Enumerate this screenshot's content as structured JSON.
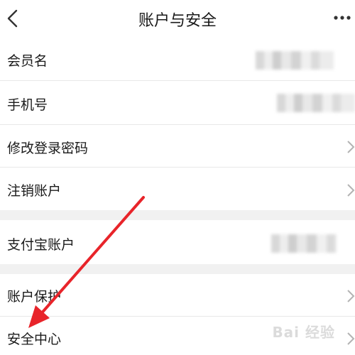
{
  "header": {
    "title": "账户与安全",
    "back_icon": "chevron-left-icon",
    "more_icon": "more-dots-icon"
  },
  "rows": [
    {
      "label": "会员名"
    },
    {
      "label": "手机号"
    },
    {
      "label": "修改登录密码"
    },
    {
      "label": "注销账户"
    },
    {
      "label": "支付宝账户"
    },
    {
      "label": "账户保护"
    },
    {
      "label": "安全中心"
    }
  ],
  "watermark": {
    "text": "Bai 经验"
  },
  "colors": {
    "background": "#ffffff",
    "section_gap": "#f1f1f1",
    "divider": "#e8e8e8",
    "text": "#1a1a1a",
    "chevron": "#b3b3b3",
    "annotation_arrow": "#e8242a"
  }
}
